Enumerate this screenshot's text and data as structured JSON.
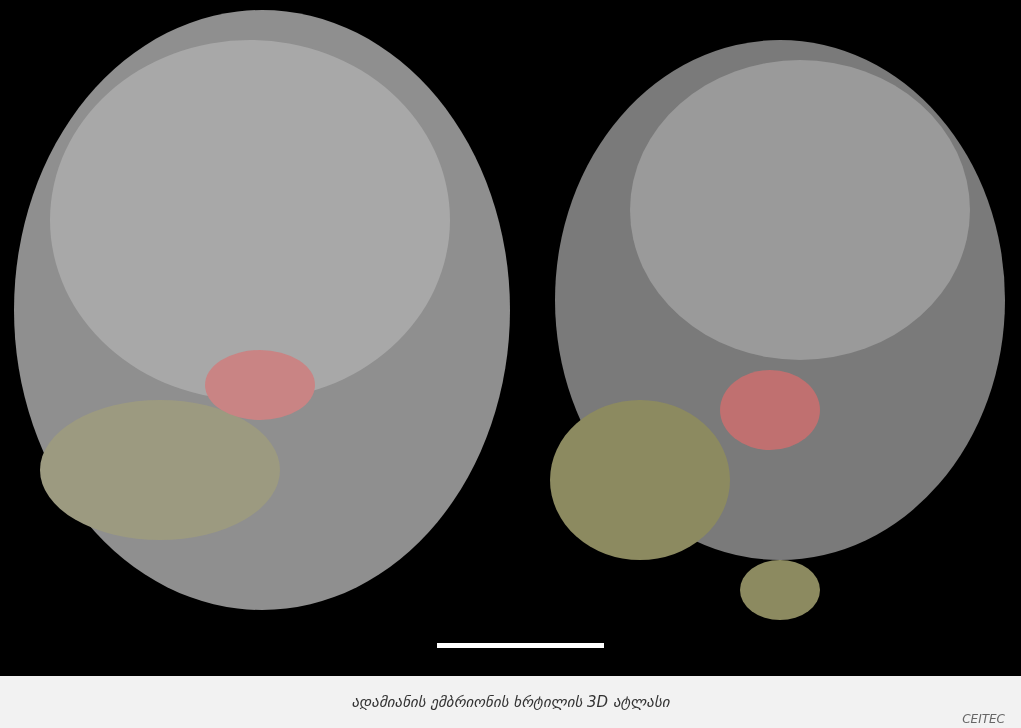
{
  "figure": {
    "caption": "ადამიანის ემბრიონის ხრტილის 3D ატლასი",
    "credit": "CEITEC"
  }
}
